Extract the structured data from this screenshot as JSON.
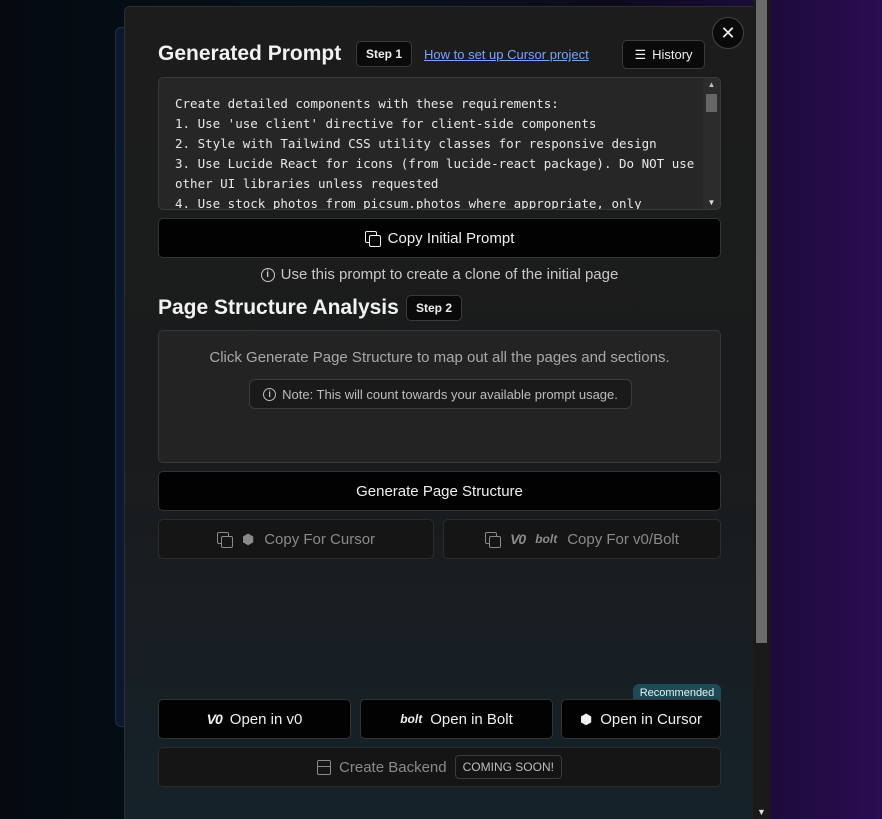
{
  "modal": {
    "close_glyph": "✕",
    "section1": {
      "title": "Generated Prompt",
      "step": "Step 1",
      "setup_link": "How to set up Cursor project",
      "history_label": "History",
      "prompt_text": "Create detailed components with these requirements:\n1. Use 'use client' directive for client-side components\n2. Style with Tailwind CSS utility classes for responsive design\n3. Use Lucide React for icons (from lucide-react package). Do NOT use other UI libraries unless requested\n4. Use stock photos from picsum.photos where appropriate, only",
      "copy_button": "Copy Initial Prompt",
      "info_text": "Use this prompt to create a clone of the initial page"
    },
    "section2": {
      "title": "Page Structure Analysis",
      "step": "Step 2",
      "description": "Click Generate Page Structure to map out all the pages and sections.",
      "note": "Note: This will count towards your available prompt usage.",
      "generate_button": "Generate Page Structure",
      "copy_cursor": "Copy For Cursor",
      "copy_v0_bolt": "Copy For v0/Bolt",
      "v0_logo": "V0",
      "bolt_logo": "bolt"
    },
    "open_buttons": {
      "recommended_badge": "Recommended",
      "v0": "Open in v0",
      "bolt": "Open in Bolt",
      "cursor": "Open in Cursor"
    },
    "backend": {
      "label": "Create Backend",
      "badge": "COMING SOON!"
    }
  }
}
